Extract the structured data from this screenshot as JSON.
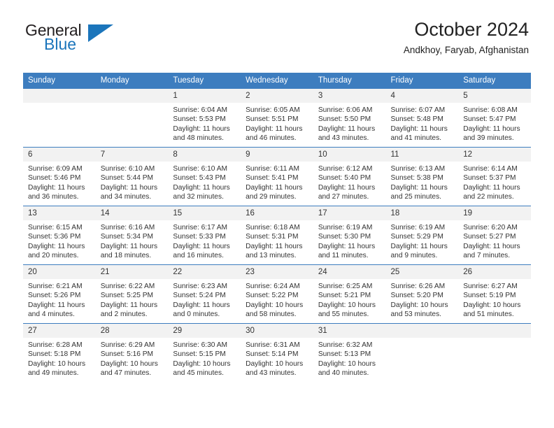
{
  "brand": {
    "name_part1": "General",
    "name_part2": "Blue",
    "triangle_icon": "triangle-icon",
    "accent_color": "#1b75bb"
  },
  "header": {
    "title": "October 2024",
    "location": "Andkhoy, Faryab, Afghanistan",
    "header_bg_color": "#3d7dbf",
    "row_divider_color": "#3d7dbf",
    "day_band_color": "#f2f2f2"
  },
  "weekday_headers": [
    "Sunday",
    "Monday",
    "Tuesday",
    "Wednesday",
    "Thursday",
    "Friday",
    "Saturday"
  ],
  "weeks": [
    [
      {
        "day": "",
        "sunrise": "",
        "sunset": "",
        "daylight_line1": "",
        "daylight_line2": "",
        "blank": true
      },
      {
        "day": "",
        "sunrise": "",
        "sunset": "",
        "daylight_line1": "",
        "daylight_line2": "",
        "blank": true
      },
      {
        "day": "1",
        "sunrise": "Sunrise: 6:04 AM",
        "sunset": "Sunset: 5:53 PM",
        "daylight_line1": "Daylight: 11 hours",
        "daylight_line2": "and 48 minutes."
      },
      {
        "day": "2",
        "sunrise": "Sunrise: 6:05 AM",
        "sunset": "Sunset: 5:51 PM",
        "daylight_line1": "Daylight: 11 hours",
        "daylight_line2": "and 46 minutes."
      },
      {
        "day": "3",
        "sunrise": "Sunrise: 6:06 AM",
        "sunset": "Sunset: 5:50 PM",
        "daylight_line1": "Daylight: 11 hours",
        "daylight_line2": "and 43 minutes."
      },
      {
        "day": "4",
        "sunrise": "Sunrise: 6:07 AM",
        "sunset": "Sunset: 5:48 PM",
        "daylight_line1": "Daylight: 11 hours",
        "daylight_line2": "and 41 minutes."
      },
      {
        "day": "5",
        "sunrise": "Sunrise: 6:08 AM",
        "sunset": "Sunset: 5:47 PM",
        "daylight_line1": "Daylight: 11 hours",
        "daylight_line2": "and 39 minutes."
      }
    ],
    [
      {
        "day": "6",
        "sunrise": "Sunrise: 6:09 AM",
        "sunset": "Sunset: 5:46 PM",
        "daylight_line1": "Daylight: 11 hours",
        "daylight_line2": "and 36 minutes."
      },
      {
        "day": "7",
        "sunrise": "Sunrise: 6:10 AM",
        "sunset": "Sunset: 5:44 PM",
        "daylight_line1": "Daylight: 11 hours",
        "daylight_line2": "and 34 minutes."
      },
      {
        "day": "8",
        "sunrise": "Sunrise: 6:10 AM",
        "sunset": "Sunset: 5:43 PM",
        "daylight_line1": "Daylight: 11 hours",
        "daylight_line2": "and 32 minutes."
      },
      {
        "day": "9",
        "sunrise": "Sunrise: 6:11 AM",
        "sunset": "Sunset: 5:41 PM",
        "daylight_line1": "Daylight: 11 hours",
        "daylight_line2": "and 29 minutes."
      },
      {
        "day": "10",
        "sunrise": "Sunrise: 6:12 AM",
        "sunset": "Sunset: 5:40 PM",
        "daylight_line1": "Daylight: 11 hours",
        "daylight_line2": "and 27 minutes."
      },
      {
        "day": "11",
        "sunrise": "Sunrise: 6:13 AM",
        "sunset": "Sunset: 5:38 PM",
        "daylight_line1": "Daylight: 11 hours",
        "daylight_line2": "and 25 minutes."
      },
      {
        "day": "12",
        "sunrise": "Sunrise: 6:14 AM",
        "sunset": "Sunset: 5:37 PM",
        "daylight_line1": "Daylight: 11 hours",
        "daylight_line2": "and 22 minutes."
      }
    ],
    [
      {
        "day": "13",
        "sunrise": "Sunrise: 6:15 AM",
        "sunset": "Sunset: 5:36 PM",
        "daylight_line1": "Daylight: 11 hours",
        "daylight_line2": "and 20 minutes."
      },
      {
        "day": "14",
        "sunrise": "Sunrise: 6:16 AM",
        "sunset": "Sunset: 5:34 PM",
        "daylight_line1": "Daylight: 11 hours",
        "daylight_line2": "and 18 minutes."
      },
      {
        "day": "15",
        "sunrise": "Sunrise: 6:17 AM",
        "sunset": "Sunset: 5:33 PM",
        "daylight_line1": "Daylight: 11 hours",
        "daylight_line2": "and 16 minutes."
      },
      {
        "day": "16",
        "sunrise": "Sunrise: 6:18 AM",
        "sunset": "Sunset: 5:31 PM",
        "daylight_line1": "Daylight: 11 hours",
        "daylight_line2": "and 13 minutes."
      },
      {
        "day": "17",
        "sunrise": "Sunrise: 6:19 AM",
        "sunset": "Sunset: 5:30 PM",
        "daylight_line1": "Daylight: 11 hours",
        "daylight_line2": "and 11 minutes."
      },
      {
        "day": "18",
        "sunrise": "Sunrise: 6:19 AM",
        "sunset": "Sunset: 5:29 PM",
        "daylight_line1": "Daylight: 11 hours",
        "daylight_line2": "and 9 minutes."
      },
      {
        "day": "19",
        "sunrise": "Sunrise: 6:20 AM",
        "sunset": "Sunset: 5:27 PM",
        "daylight_line1": "Daylight: 11 hours",
        "daylight_line2": "and 7 minutes."
      }
    ],
    [
      {
        "day": "20",
        "sunrise": "Sunrise: 6:21 AM",
        "sunset": "Sunset: 5:26 PM",
        "daylight_line1": "Daylight: 11 hours",
        "daylight_line2": "and 4 minutes."
      },
      {
        "day": "21",
        "sunrise": "Sunrise: 6:22 AM",
        "sunset": "Sunset: 5:25 PM",
        "daylight_line1": "Daylight: 11 hours",
        "daylight_line2": "and 2 minutes."
      },
      {
        "day": "22",
        "sunrise": "Sunrise: 6:23 AM",
        "sunset": "Sunset: 5:24 PM",
        "daylight_line1": "Daylight: 11 hours",
        "daylight_line2": "and 0 minutes."
      },
      {
        "day": "23",
        "sunrise": "Sunrise: 6:24 AM",
        "sunset": "Sunset: 5:22 PM",
        "daylight_line1": "Daylight: 10 hours",
        "daylight_line2": "and 58 minutes."
      },
      {
        "day": "24",
        "sunrise": "Sunrise: 6:25 AM",
        "sunset": "Sunset: 5:21 PM",
        "daylight_line1": "Daylight: 10 hours",
        "daylight_line2": "and 55 minutes."
      },
      {
        "day": "25",
        "sunrise": "Sunrise: 6:26 AM",
        "sunset": "Sunset: 5:20 PM",
        "daylight_line1": "Daylight: 10 hours",
        "daylight_line2": "and 53 minutes."
      },
      {
        "day": "26",
        "sunrise": "Sunrise: 6:27 AM",
        "sunset": "Sunset: 5:19 PM",
        "daylight_line1": "Daylight: 10 hours",
        "daylight_line2": "and 51 minutes."
      }
    ],
    [
      {
        "day": "27",
        "sunrise": "Sunrise: 6:28 AM",
        "sunset": "Sunset: 5:18 PM",
        "daylight_line1": "Daylight: 10 hours",
        "daylight_line2": "and 49 minutes."
      },
      {
        "day": "28",
        "sunrise": "Sunrise: 6:29 AM",
        "sunset": "Sunset: 5:16 PM",
        "daylight_line1": "Daylight: 10 hours",
        "daylight_line2": "and 47 minutes."
      },
      {
        "day": "29",
        "sunrise": "Sunrise: 6:30 AM",
        "sunset": "Sunset: 5:15 PM",
        "daylight_line1": "Daylight: 10 hours",
        "daylight_line2": "and 45 minutes."
      },
      {
        "day": "30",
        "sunrise": "Sunrise: 6:31 AM",
        "sunset": "Sunset: 5:14 PM",
        "daylight_line1": "Daylight: 10 hours",
        "daylight_line2": "and 43 minutes."
      },
      {
        "day": "31",
        "sunrise": "Sunrise: 6:32 AM",
        "sunset": "Sunset: 5:13 PM",
        "daylight_line1": "Daylight: 10 hours",
        "daylight_line2": "and 40 minutes."
      },
      {
        "day": "",
        "sunrise": "",
        "sunset": "",
        "daylight_line1": "",
        "daylight_line2": "",
        "blank": true
      },
      {
        "day": "",
        "sunrise": "",
        "sunset": "",
        "daylight_line1": "",
        "daylight_line2": "",
        "blank": true
      }
    ]
  ]
}
